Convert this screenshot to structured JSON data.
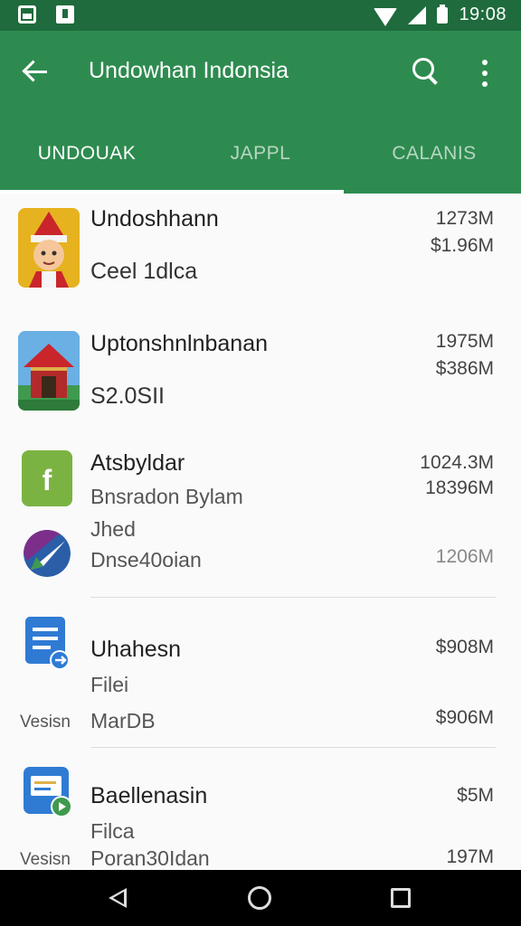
{
  "status_bar": {
    "time": "19:08"
  },
  "app_bar": {
    "title": "Undowhan Indonsia"
  },
  "tabs": [
    {
      "label": "UNDOUAK",
      "active": true
    },
    {
      "label": "JAPPL",
      "active": false
    },
    {
      "label": "CALANIS",
      "active": false
    }
  ],
  "items": [
    {
      "title": "Undoshhann",
      "subtitle": "Ceel 1dlca",
      "value1": "1273M",
      "value2": "$1.96M",
      "icon": "character-icon"
    },
    {
      "title": "Uptonshnlnbanan",
      "subtitle": "S2.0SII",
      "value1": "1975M",
      "value2": "$386M",
      "icon": "house-icon"
    },
    {
      "title": "Atsbyldar",
      "subtitle": "Bnsradon Bylam",
      "line3": "Jhed",
      "line4": "Dnse40oian",
      "value1": "1024.3M",
      "value2": "18396M",
      "value3": "1206M",
      "icon": "f-app-icon"
    },
    {
      "title": "Uhahesn",
      "subtitle": "Filei",
      "line3": "MarDB",
      "side": "Vesisn",
      "value1": "$908M",
      "value2": "$906M",
      "icon": "document-icon"
    },
    {
      "title": "Baellenasin",
      "subtitle": "Filca",
      "line3": "Poran30Idan",
      "side": "Vesisn",
      "value1": "$5M",
      "value2": "197M",
      "icon": "slides-icon"
    }
  ],
  "colors": {
    "primary": "#2e8b50",
    "status": "#1f6b3d"
  }
}
